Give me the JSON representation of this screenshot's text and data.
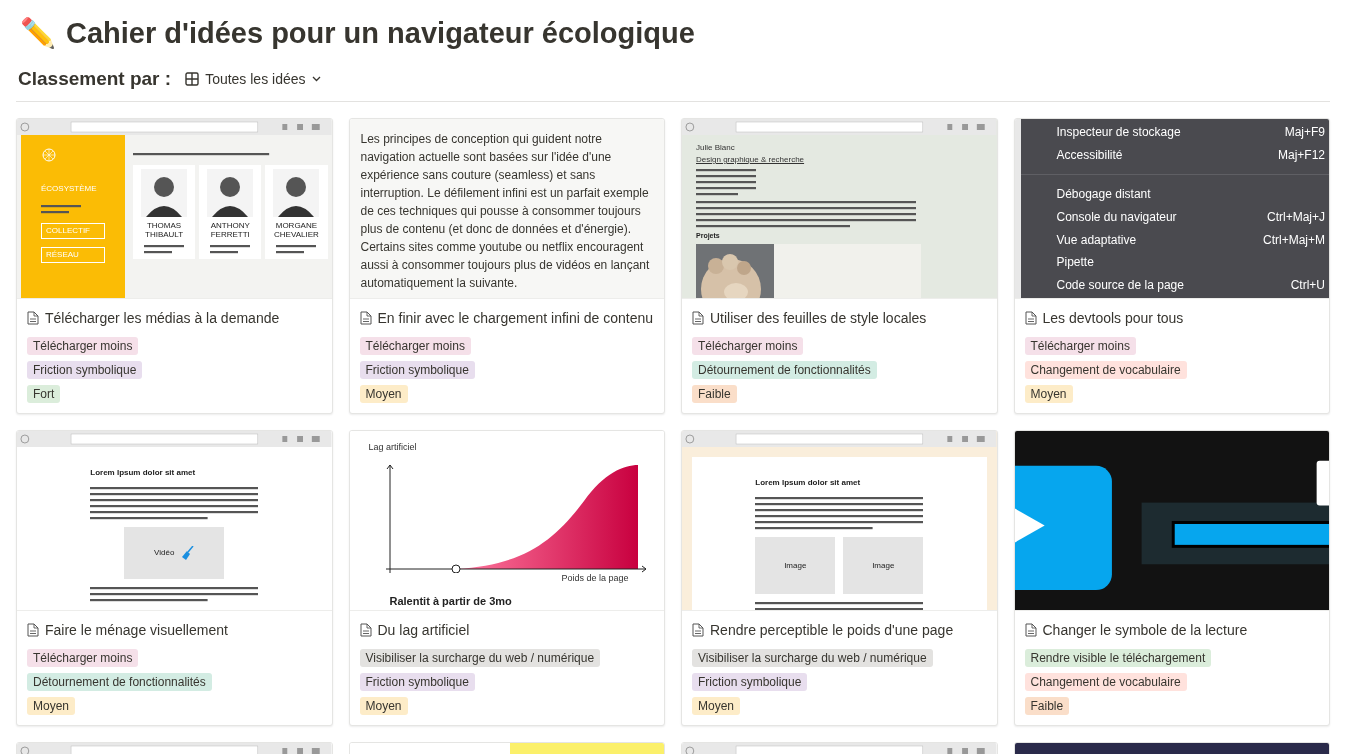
{
  "title_icon": "✏️",
  "title": "Cahier d'idées pour un navigateur écologique",
  "sort": {
    "label": "Classement par :",
    "value": "Toutes les idées"
  },
  "cards": [
    {
      "title": "Télécharger les médias à la demande",
      "preview": {
        "kind": "site",
        "heading": "ÉCOSYSTÈME",
        "buttons": [
          "COLLECTIF",
          "RÉSEAU"
        ],
        "people": [
          "THOMAS THIBAULT",
          "ANTHONY FERRETTI",
          "MORGANE CHEVALIER"
        ]
      },
      "tags": [
        {
          "text": "Télécharger moins",
          "color": "#f5e0e9"
        },
        {
          "text": "Friction symbolique",
          "color": "#e8deee"
        },
        {
          "text": "Fort",
          "color": "#dbeddb"
        }
      ]
    },
    {
      "title": "En finir avec le chargement infini de contenu",
      "preview": {
        "kind": "text",
        "text": "Les principes de conception qui guident notre navigation actuelle sont basées sur l'idée d'une expérience sans couture (seamless) et sans interruption. Le défilement infini est un parfait exemple de ces techniques qui pousse à consommer toujours plus de contenu (et donc de données et d'énergie). Certains sites comme youtube ou netflix encouragent aussi à consommer toujours plus de vidéos en lançant automatiquement la suivante."
      },
      "tags": [
        {
          "text": "Télécharger moins",
          "color": "#f5e0e9"
        },
        {
          "text": "Friction symbolique",
          "color": "#e8deee"
        },
        {
          "text": "Moyen",
          "color": "#fdecc8"
        }
      ]
    },
    {
      "title": "Utiliser des feuilles de style locales",
      "preview": {
        "kind": "profile",
        "name": "Julie Blanc",
        "link": "Design graphique & recherche",
        "section": "Projets"
      },
      "tags": [
        {
          "text": "Télécharger moins",
          "color": "#f5e0e9"
        },
        {
          "text": "Détournement de fonctionnalités",
          "color": "#d3ece3"
        },
        {
          "text": "Faible",
          "color": "#fadec9"
        }
      ]
    },
    {
      "title": "Les devtools pour tous",
      "preview": {
        "kind": "menu",
        "items": [
          {
            "kind": "item",
            "label": "Inspecteur de stockage",
            "shortcut": "Maj+F9"
          },
          {
            "kind": "item",
            "label": "Accessibilité",
            "shortcut": "Maj+F12"
          },
          {
            "kind": "separator"
          },
          {
            "kind": "item",
            "label": "Débogage distant"
          },
          {
            "kind": "item",
            "label": "Console du navigateur",
            "shortcut": "Ctrl+Maj+J"
          },
          {
            "kind": "item",
            "label": "Vue adaptative",
            "shortcut": "Ctrl+Maj+M"
          },
          {
            "kind": "item",
            "label": "Pipette"
          },
          {
            "kind": "item",
            "label": "Code source de la page",
            "shortcut": "Ctrl+U"
          }
        ]
      },
      "tags": [
        {
          "text": "Télécharger moins",
          "color": "#f5e0e9"
        },
        {
          "text": "Changement de vocabulaire",
          "color": "#ffe2dd"
        },
        {
          "text": "Moyen",
          "color": "#fdecc8"
        }
      ]
    },
    {
      "title": "Faire le ménage visuellement",
      "preview": {
        "kind": "article",
        "heading": "Lorem Ipsum dolor sit amet",
        "media": [
          {
            "kind": "video",
            "label": "Vidéo"
          }
        ]
      },
      "tags": [
        {
          "text": "Télécharger moins",
          "color": "#f5e0e9"
        },
        {
          "text": "Détournement de fonctionnalités",
          "color": "#d3ece3"
        },
        {
          "text": "Moyen",
          "color": "#fdecc8"
        }
      ]
    },
    {
      "title": "Du lag artificiel",
      "preview": {
        "kind": "chart",
        "ylabel": "Lag artificiel",
        "xlabel": "Poids de la page",
        "caption": "Ralentit à partir de 3mo"
      },
      "tags": [
        {
          "text": "Visibiliser la surcharge du web / numérique",
          "color": "#e3e2e0"
        },
        {
          "text": "Friction symbolique",
          "color": "#e8deee"
        },
        {
          "text": "Moyen",
          "color": "#fdecc8"
        }
      ]
    },
    {
      "title": "Rendre perceptible le poids d'une page",
      "preview": {
        "kind": "article",
        "heading": "Lorem Ipsum dolor sit amet",
        "media": [
          {
            "label": "Image"
          },
          {
            "label": "Image"
          }
        ]
      },
      "tags": [
        {
          "text": "Visibiliser la surcharge du web / numérique",
          "color": "#e3e2e0"
        },
        {
          "text": "Friction symbolique",
          "color": "#e8deee"
        },
        {
          "text": "Moyen",
          "color": "#fdecc8"
        }
      ]
    },
    {
      "title": "Changer le symbole de la lecture",
      "preview": {
        "kind": "player"
      },
      "tags": [
        {
          "text": "Rendre visible le téléchargement",
          "color": "#dbeddb"
        },
        {
          "text": "Changement de vocabulaire",
          "color": "#ffe2dd"
        },
        {
          "text": "Faible",
          "color": "#fadec9"
        }
      ]
    }
  ],
  "more_cards": [
    {
      "kind": "browser"
    },
    {
      "kind": "note"
    },
    {
      "kind": "browser"
    },
    {
      "kind": "dark"
    }
  ]
}
